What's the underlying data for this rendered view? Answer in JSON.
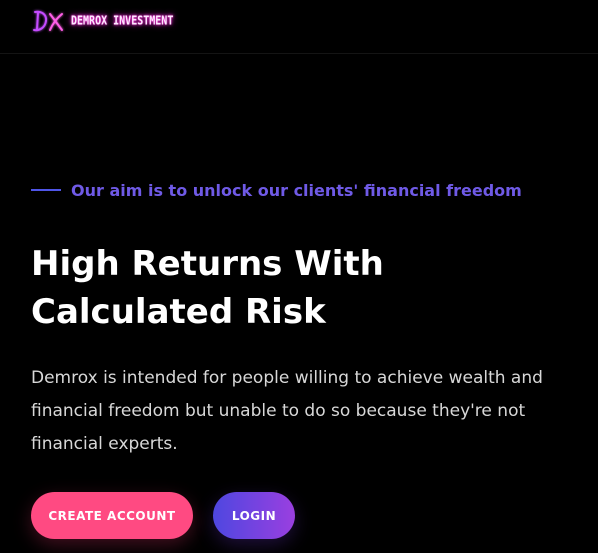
{
  "brand": {
    "logo_mark_text": "DX",
    "name": "DEMROX INVESTMENT"
  },
  "hero": {
    "tagline": "Our aim is to unlock our clients' financial freedom",
    "title": "High Returns With Calculated Risk",
    "description": "Demrox is intended for people willing to achieve wealth and financial freedom but unable to do so because they're not financial experts."
  },
  "actions": {
    "create_account_label": "CREATE ACCOUNT",
    "login_label": "LOGIN"
  },
  "colors": {
    "background": "#000000",
    "tagline": "#6f5ae6",
    "tagline_line": "#4f55e8",
    "create_button": "#ff4a82",
    "login_gradient_start": "#4e47e0",
    "login_gradient_end": "#9a3fe0",
    "logo_glow": "#ff3ad8"
  }
}
